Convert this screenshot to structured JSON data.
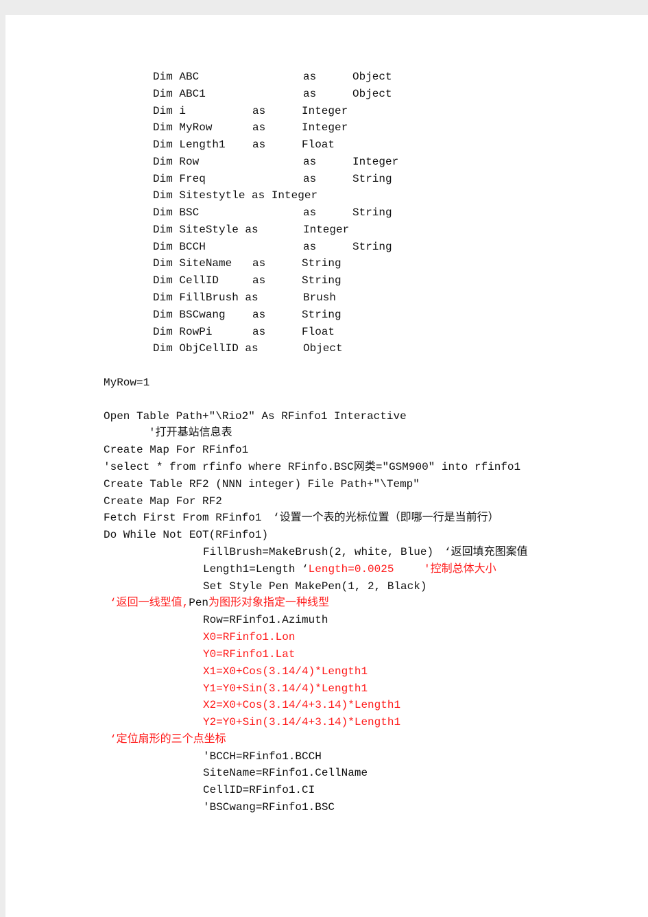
{
  "dims": [
    {
      "name": "Dim ABC",
      "as": "as",
      "type": "Object"
    },
    {
      "name": "Dim ABC1",
      "as": "as",
      "type": "Object"
    },
    {
      "name": "Dim i",
      "as": "as",
      "type": "Integer"
    },
    {
      "name": "Dim MyRow",
      "as": "as",
      "type": "Integer"
    },
    {
      "name": "Dim Length1",
      "as": "as",
      "type": "Float"
    },
    {
      "name": "Dim Row",
      "as": "as",
      "type": "Integer"
    },
    {
      "name": "Dim Freq",
      "as": "as",
      "type": "String"
    },
    {
      "name": "Dim Sitestytle as Integer"
    },
    {
      "name": "Dim BSC",
      "as": "as",
      "type": "String"
    },
    {
      "name": "Dim SiteStyle as",
      "type": "Integer"
    },
    {
      "name": "Dim BCCH",
      "as": "as",
      "type": "String"
    },
    {
      "name": "Dim SiteName",
      "as": "as",
      "type": "String"
    },
    {
      "name": "Dim CellID",
      "as": "as",
      "type": "String"
    },
    {
      "name": "Dim FillBrush as",
      "type": "Brush"
    },
    {
      "name": "Dim BSCwang",
      "as": "as",
      "type": "String"
    },
    {
      "name": "Dim RowPi",
      "as": "as",
      "type": "Float"
    },
    {
      "name": "Dim ObjCellID as",
      "type": "Object"
    }
  ],
  "code": {
    "myrow": "MyRow=1",
    "open": "Open Table Path+\"\\Rio2\" As RFinfo1 Interactive",
    "open_comment": "'打开基站信息表",
    "create_map1": "Create Map For RFinfo1",
    "select": "'select * from rfinfo where RFinfo.BSC网类=\"GSM900\" into rfinfo1",
    "create_table": "Create Table RF2 (NNN integer) File Path+\"\\Temp\"",
    "create_map2": "Create Map For RF2",
    "fetch": "Fetch First From RFinfo1",
    "fetch_comment": "‘设置一个表的光标位置（即哪一行是当前行）",
    "do_while": "Do While Not EOT(RFinfo1)",
    "fillbrush": "FillBrush=MakeBrush(2, white, Blue)",
    "fillbrush_comment": "‘返回填充图案值",
    "length1": "Length1=Length ",
    "length1_q": "‘",
    "length1_val": "Length=0.0025",
    "length1_comment": "'控制总体大小",
    "setstyle": "Set Style Pen MakePen(1, 2, Black)",
    "pen_comment_a": "‘返回一线型值,",
    "pen_comment_b": "Pen",
    "pen_comment_c": "为图形对象指定一种线型",
    "row": "Row=RFinfo1.Azimuth",
    "x0": "X0=RFinfo1.Lon",
    "y0": "Y0=RFinfo1.Lat",
    "x1": "X1=X0+Cos(3.14/4)*Length1",
    "y1": "Y1=Y0+Sin(3.14/4)*Length1",
    "x2": "X2=X0+Cos(3.14/4+3.14)*Length1",
    "y2": "Y2=Y0+Sin(3.14/4+3.14)*Length1",
    "pts_comment": "‘定位扇形的三个点坐标",
    "bcch": "'BCCH=RFinfo1.BCCH",
    "sitename": "SiteName=RFinfo1.CellName",
    "cellid": "CellID=RFinfo1.CI",
    "bscwang": "'BSCwang=RFinfo1.BSC"
  },
  "colors": {
    "comment_red": "#ff1a1a",
    "text": "#111111"
  }
}
